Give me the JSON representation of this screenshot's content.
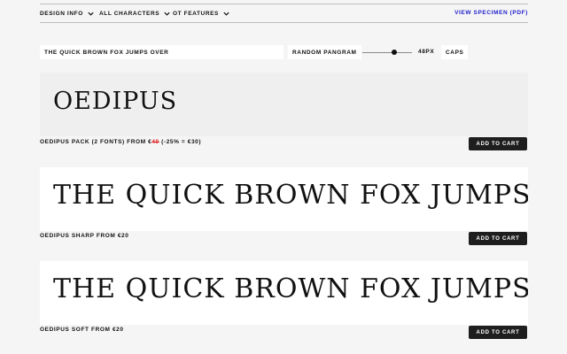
{
  "nav": {
    "design_info": "DESIGN INFO",
    "all_characters": "ALL CHARACTERS",
    "ot_features": "OT FEATURES",
    "view_specimen": "VIEW SPECIMEN (PDF)",
    "link_color": "#2222cc"
  },
  "toolbar": {
    "sample_text": "THE QUICK BROWN FOX JUMPS OVER",
    "random_pangram": "RANDOM PANGRAM",
    "size": "48PX",
    "size_fraction": 0.65,
    "caps": "CAPS"
  },
  "products": [
    {
      "specimen": "OEDIPUS",
      "price_prefix": "OEDIPUS PACK (2 FONTS) FROM €",
      "old_price": "40",
      "price_suffix": " (-25% = €30)",
      "button": "ADD TO CART"
    },
    {
      "specimen": "THE QUICK BROWN FOX JUMPS OVER THE LAZY DOG",
      "price": "OEDIPUS SHARP FROM €20",
      "button": "ADD TO CART"
    },
    {
      "specimen": "THE QUICK BROWN FOX JUMPS OVER THE LAZY DOG",
      "price": "OEDIPUS SOFT FROM €20",
      "button": "ADD TO CART"
    }
  ],
  "colors": {
    "button_bg": "#1e1e1e",
    "discount_red": "#e02020"
  }
}
